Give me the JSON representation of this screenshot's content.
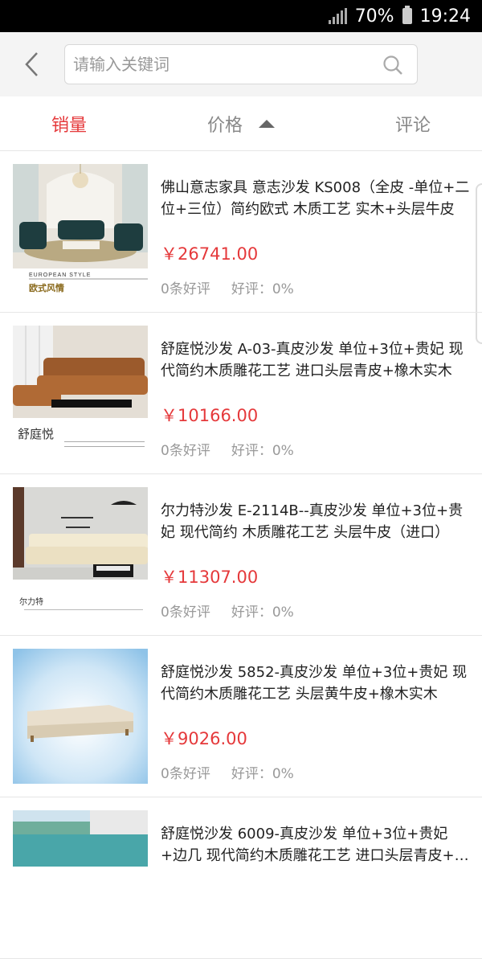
{
  "status_bar": {
    "battery": "70%",
    "time": "19:24",
    "icons": [
      "signal-icon",
      "battery-icon"
    ]
  },
  "search": {
    "placeholder": "请输入关键词",
    "value": ""
  },
  "sort_tabs": [
    {
      "label": "销量",
      "active": true
    },
    {
      "label": "价格",
      "active": false,
      "arrow": "up"
    },
    {
      "label": "评论",
      "active": false
    }
  ],
  "products": [
    {
      "title": "佛山意志家具 意志沙发 KS008（全皮 -单位+二位+三位）简约欧式 木质工艺 实木+头层牛皮",
      "price": "￥26741.00",
      "reviews": "0条好评",
      "rating": "好评：0%",
      "image_caption": "EUROPEAN STYLE",
      "image_subcaption": "欧式风情"
    },
    {
      "title": "舒庭悦沙发 A-03-真皮沙发  单位+3位+贵妃 现代简约木质雕花工艺 进口头层青皮+橡木实木",
      "price": "￥10166.00",
      "reviews": "0条好评",
      "rating": "好评：0%",
      "image_caption": "舒庭悦"
    },
    {
      "title": "尔力特沙发 E-2114B--真皮沙发 单位+3位+贵妃 现代简约 木质雕花工艺 头层牛皮（进口）",
      "price": "￥11307.00",
      "reviews": "0条好评",
      "rating": "好评：0%",
      "image_caption": "尔力特"
    },
    {
      "title": "舒庭悦沙发 5852-真皮沙发 单位+3位+贵妃 现代简约木质雕花工艺 头层黄牛皮+橡木实木",
      "price": "￥9026.00",
      "reviews": "0条好评",
      "rating": "好评：0%"
    },
    {
      "title": "舒庭悦沙发 6009-真皮沙发 单位+3位+贵妃+边几 现代简约木质雕花工艺 进口头层青皮+橡木实木",
      "price": "",
      "reviews": "",
      "rating": ""
    }
  ],
  "colors": {
    "accent": "#e5393b",
    "muted": "#999999",
    "header_bg": "#f4f4f4"
  }
}
